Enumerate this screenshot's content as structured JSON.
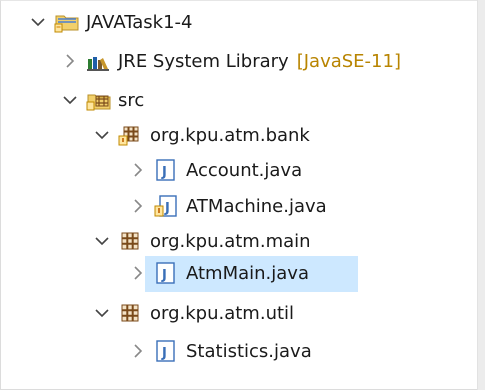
{
  "tree": {
    "items": [
      {
        "label": "JAVATask1-4",
        "decoration": ""
      },
      {
        "label": "JRE System Library",
        "decoration": "[JavaSE-11]"
      },
      {
        "label": "src",
        "decoration": ""
      },
      {
        "label": "org.kpu.atm.bank",
        "decoration": ""
      },
      {
        "label": "Account.java",
        "decoration": ""
      },
      {
        "label": "ATMachine.java",
        "decoration": ""
      },
      {
        "label": "org.kpu.atm.main",
        "decoration": ""
      },
      {
        "label": "AtmMain.java",
        "decoration": ""
      },
      {
        "label": "org.kpu.atm.util",
        "decoration": ""
      },
      {
        "label": "Statistics.java",
        "decoration": ""
      }
    ]
  },
  "colors": {
    "selection": "#cde8ff",
    "package_icon": "#7a4a1a",
    "java_file_icon": "#3a6fb8",
    "decoration_text": "#b88400"
  }
}
